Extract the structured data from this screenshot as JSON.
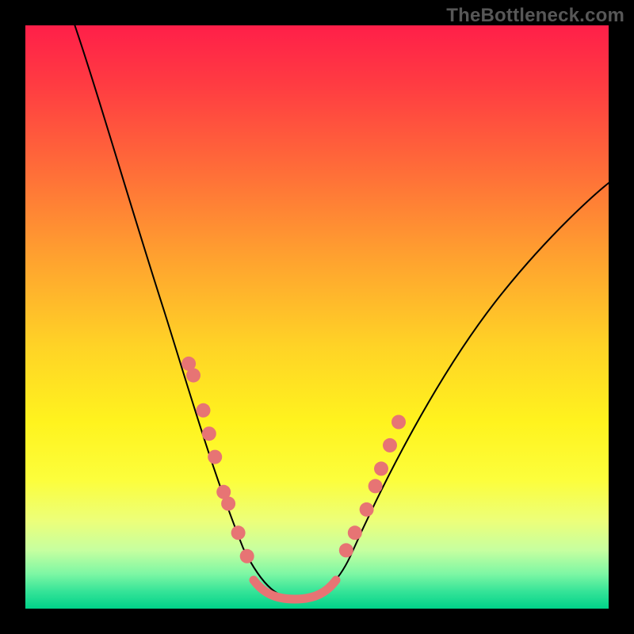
{
  "watermark": "TheBottleneck.com",
  "colors": {
    "dot": "#e77474",
    "curve": "#000000",
    "background_top": "#ff1f49",
    "background_bottom": "#00d289"
  },
  "chart_data": {
    "type": "line",
    "title": "",
    "xlabel": "",
    "ylabel": "",
    "xlim": [
      0,
      100
    ],
    "ylim": [
      0,
      100
    ],
    "annotations": [
      "TheBottleneck.com"
    ],
    "curve": {
      "description": "Asymmetric V-shaped bottleneck curve with minimum near x≈45, left branch steeper than right.",
      "x": [
        8,
        12,
        16,
        20,
        24,
        28,
        30,
        32,
        34,
        36,
        38,
        40,
        42,
        44,
        46,
        48,
        50,
        52,
        56,
        60,
        66,
        72,
        78,
        84,
        90,
        96,
        100
      ],
      "y": [
        100,
        90,
        80,
        70,
        58,
        44,
        37,
        31,
        26,
        21,
        16,
        11,
        7,
        4,
        2,
        2,
        3,
        5,
        10,
        16,
        25,
        33,
        41,
        48,
        55,
        61,
        65
      ]
    },
    "flat_bottom_segment": {
      "x_start": 40,
      "x_end": 52,
      "y": 2
    },
    "dots_left_branch": [
      {
        "x": 28.0,
        "y": 42
      },
      {
        "x": 28.8,
        "y": 40
      },
      {
        "x": 30.5,
        "y": 34
      },
      {
        "x": 31.5,
        "y": 30
      },
      {
        "x": 32.5,
        "y": 26
      },
      {
        "x": 34.0,
        "y": 20
      },
      {
        "x": 34.8,
        "y": 18
      },
      {
        "x": 36.5,
        "y": 13
      },
      {
        "x": 38.0,
        "y": 9
      }
    ],
    "dots_right_branch": [
      {
        "x": 55.0,
        "y": 10
      },
      {
        "x": 56.5,
        "y": 13
      },
      {
        "x": 58.5,
        "y": 17
      },
      {
        "x": 60.0,
        "y": 21
      },
      {
        "x": 61.0,
        "y": 24
      },
      {
        "x": 62.5,
        "y": 28
      },
      {
        "x": 64.0,
        "y": 32
      }
    ]
  }
}
